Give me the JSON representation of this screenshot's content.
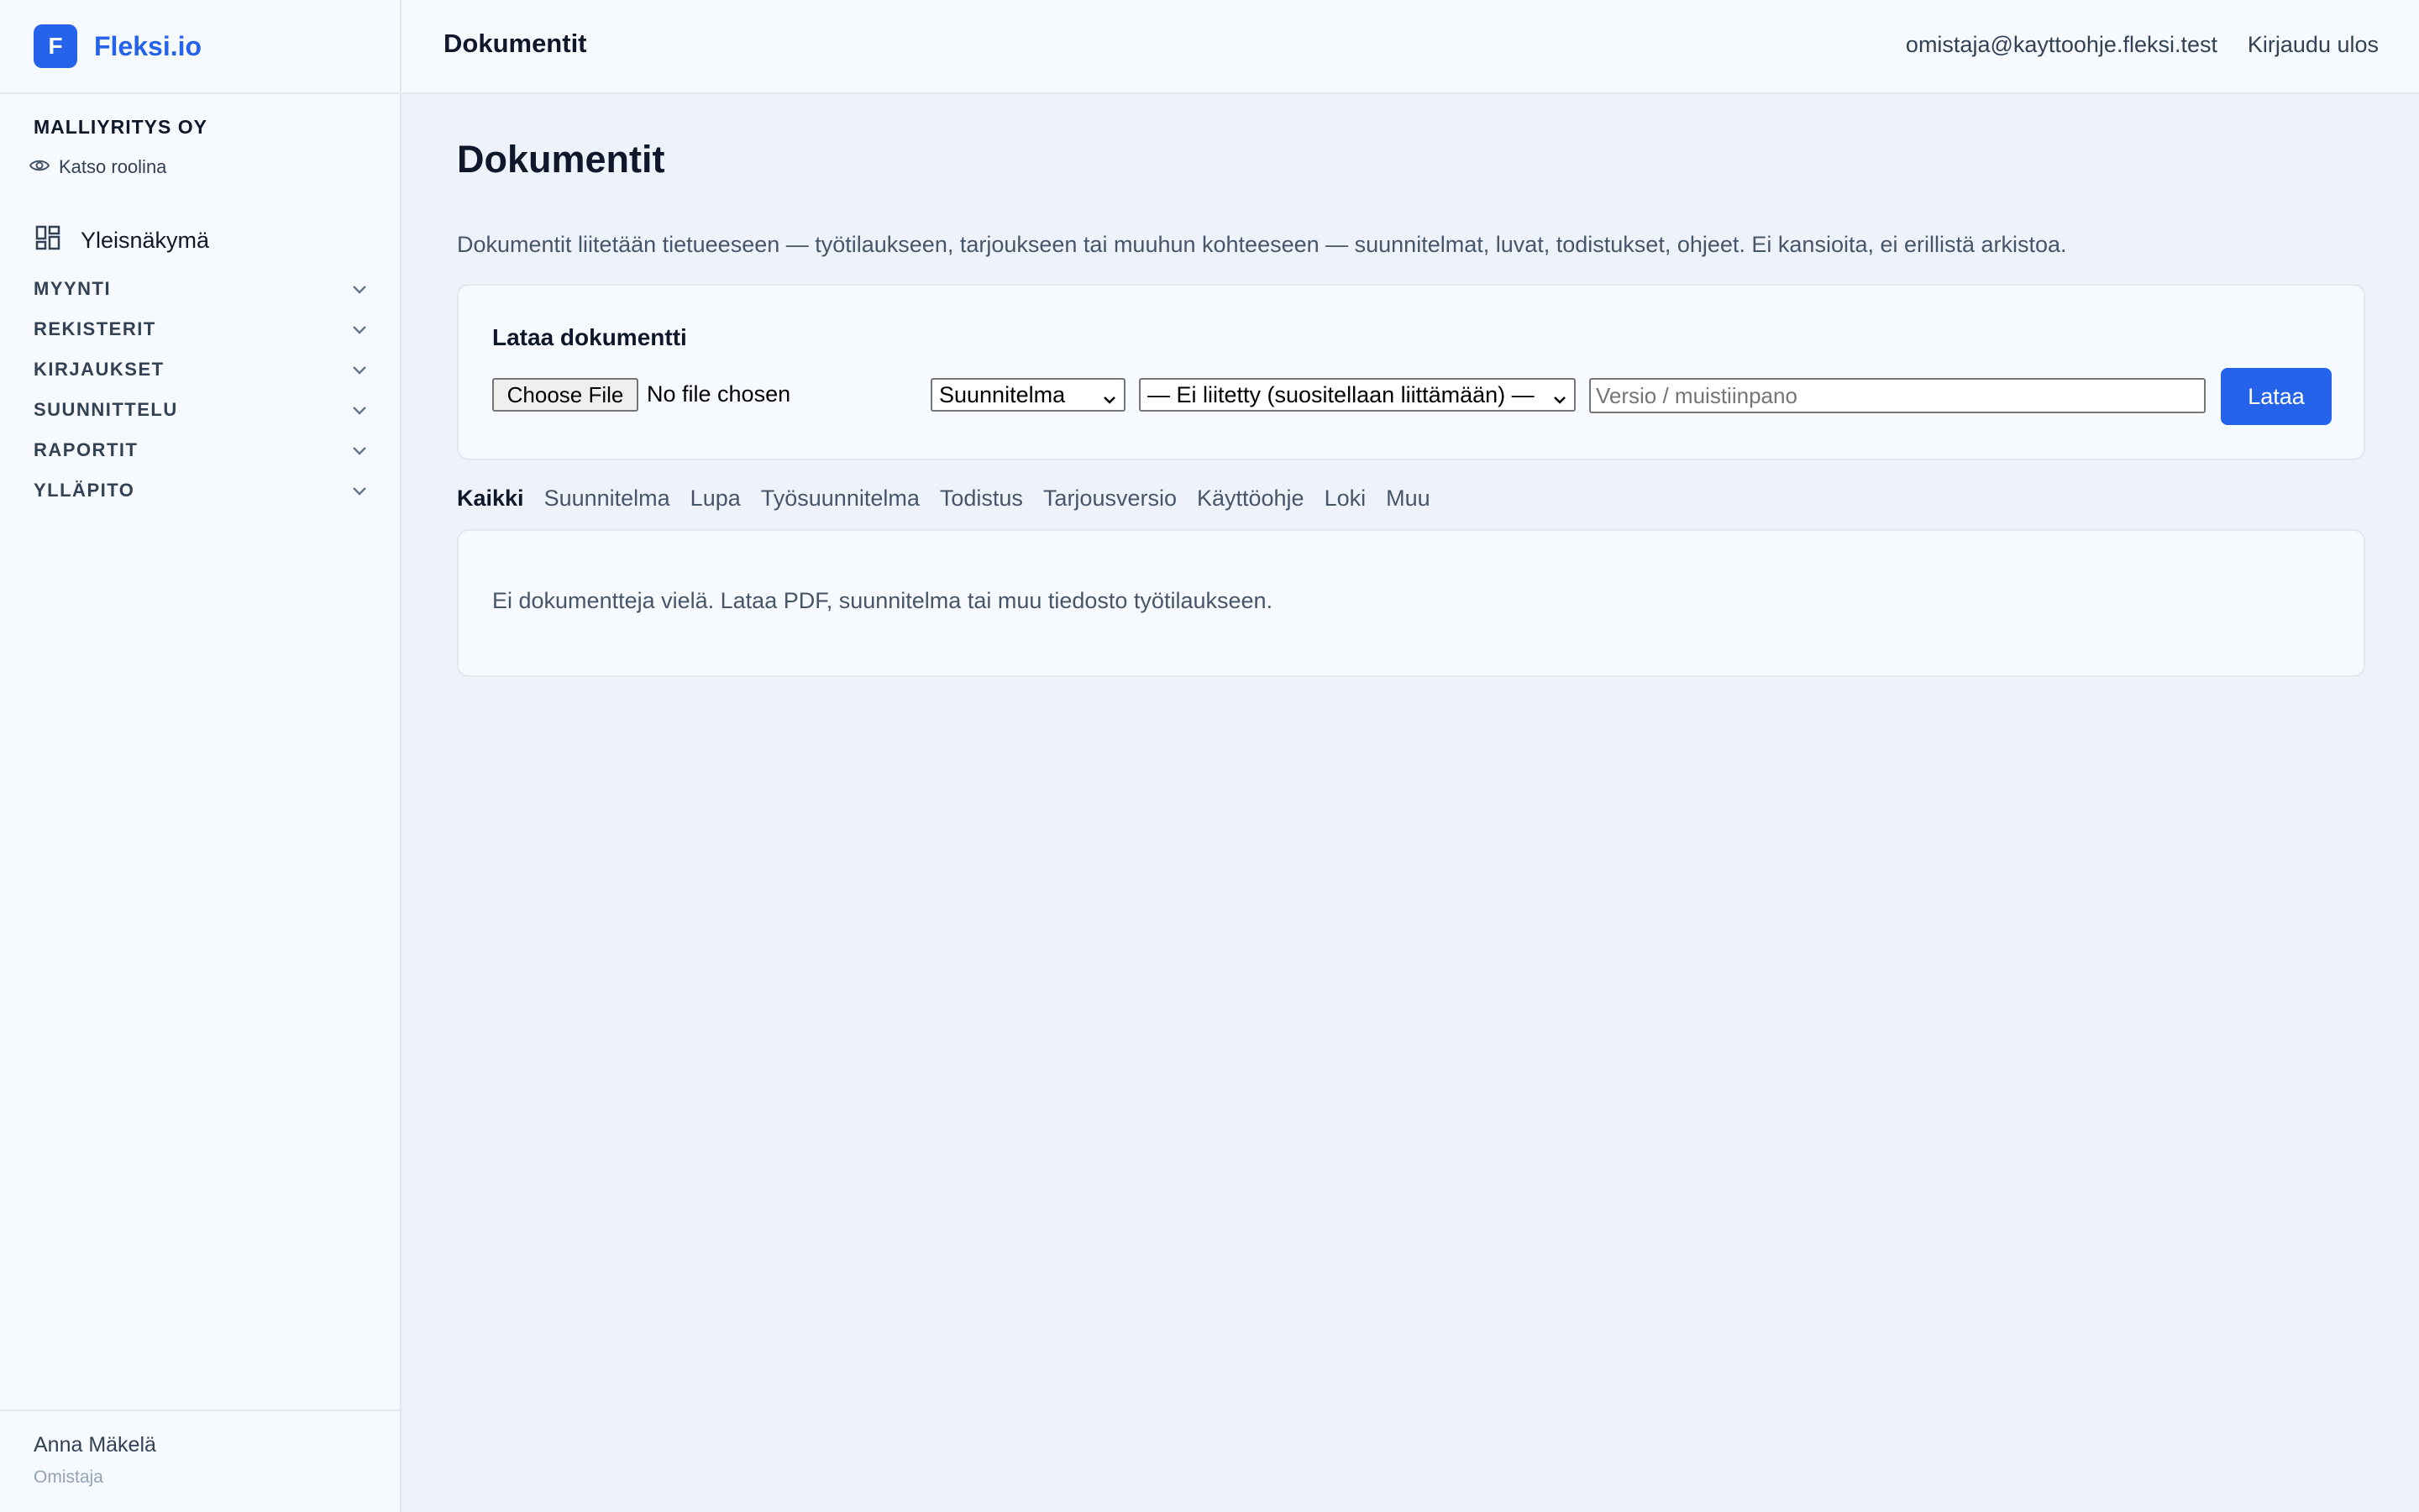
{
  "brand": {
    "logo_letter": "F",
    "name": "Fleksi.io",
    "color": "#2563eb"
  },
  "sidebar": {
    "company": "MALLIYRITYS OY",
    "view_role": "Katso roolina",
    "overview": "Yleisnäkymä",
    "sections": [
      {
        "label": "MYYNTI"
      },
      {
        "label": "REKISTERIT"
      },
      {
        "label": "KIRJAUKSET"
      },
      {
        "label": "SUUNNITTELU"
      },
      {
        "label": "RAPORTIT"
      },
      {
        "label": "YLLÄPITO"
      }
    ],
    "user": {
      "name": "Anna Mäkelä",
      "role": "Omistaja"
    }
  },
  "topbar": {
    "title": "Dokumentit",
    "email": "omistaja@kayttoohje.fleksi.test",
    "logout": "Kirjaudu ulos"
  },
  "main": {
    "title": "Dokumentit",
    "description": "Dokumentit liitetään tietueeseen — työtilaukseen, tarjoukseen tai muuhun kohteeseen — suunnitelmat, luvat, todistukset, ohjeet. Ei kansioita, ei erillistä arkistoa.",
    "upload": {
      "title": "Lataa dokumentti",
      "choose_file": "Choose File",
      "file_status": "No file chosen",
      "type_selected": "Suunnitelma",
      "link_selected": "— Ei liitetty (suositellaan liittämään) —",
      "note_placeholder": "Versio / muistiinpano",
      "button": "Lataa"
    },
    "tabs": [
      {
        "label": "Kaikki",
        "active": true
      },
      {
        "label": "Suunnitelma"
      },
      {
        "label": "Lupa"
      },
      {
        "label": "Työsuunnitelma"
      },
      {
        "label": "Todistus"
      },
      {
        "label": "Tarjousversio"
      },
      {
        "label": "Käyttöohje"
      },
      {
        "label": "Loki"
      },
      {
        "label": "Muu"
      }
    ],
    "empty_message": "Ei dokumentteja vielä. Lataa PDF, suunnitelma tai muu tiedosto työtilaukseen."
  }
}
